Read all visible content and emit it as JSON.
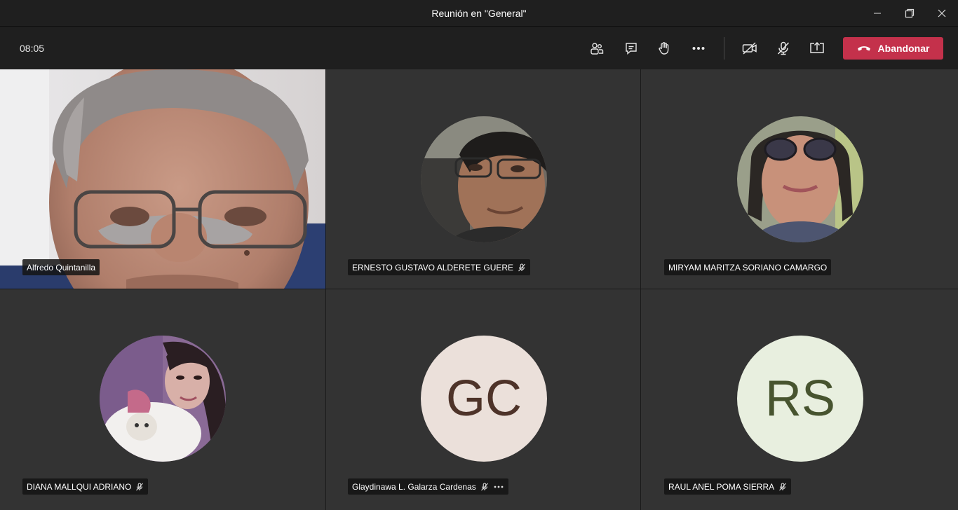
{
  "window": {
    "title": "Reunión en \"General\""
  },
  "toolbar": {
    "timer": "08:05",
    "leave_label": "Abandonar"
  },
  "participants": [
    {
      "name": "Alfredo Quintanilla",
      "muted": false
    },
    {
      "name": "ERNESTO GUSTAVO ALDERETE GUERE",
      "muted": true
    },
    {
      "name": "MIRYAM MARITZA SORIANO CAMARGO",
      "muted": false
    },
    {
      "name": "DIANA MALLQUI ADRIANO",
      "muted": true
    },
    {
      "name": "Glaydinawa L. Galarza Cardenas",
      "muted": true,
      "initials": "GC"
    },
    {
      "name": "RAUL ANEL POMA SIERRA",
      "muted": true,
      "initials": "RS"
    }
  ],
  "colors": {
    "leave": "#c4314b",
    "avatar_gc_bg": "#ebe0da",
    "avatar_gc_fg": "#4e3329",
    "avatar_rs_bg": "#e8efdf",
    "avatar_rs_fg": "#47542f"
  }
}
